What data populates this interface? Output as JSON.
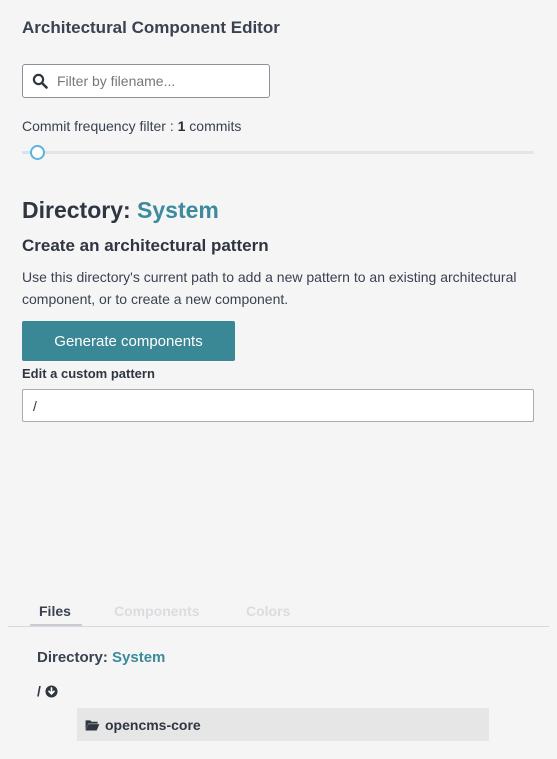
{
  "app": {
    "title": "Architectural Component Editor"
  },
  "search": {
    "placeholder": "Filter by filename...",
    "value": ""
  },
  "commit_filter": {
    "label": "Commit frequency filter : ",
    "value": "1",
    "unit": " commits",
    "slider_fraction": 0.03
  },
  "directory": {
    "label": "Directory: ",
    "name": "System"
  },
  "pattern_section": {
    "title": "Create an architectural pattern",
    "description": "Use this directory's current path to add a new pattern to an existing architectural component, or to create a new component.",
    "generate_label": "Generate components",
    "custom_label": "Edit a custom pattern",
    "custom_value": "/"
  },
  "tabs": [
    {
      "label": "Files",
      "active": true
    },
    {
      "label": "Components",
      "active": false
    },
    {
      "label": "Colors",
      "active": false
    }
  ],
  "files_panel": {
    "directory_label": "Directory: ",
    "directory_name": "System",
    "root_path": "/",
    "folders": [
      {
        "name": "opencms-core"
      }
    ]
  },
  "colors": {
    "accent": "#3b8b9c",
    "button": "#3a8796",
    "slider": "#5fb3d9"
  },
  "icons": {
    "search": "search-icon",
    "download": "circle-arrow-down-icon",
    "folder": "folder-open-icon"
  }
}
